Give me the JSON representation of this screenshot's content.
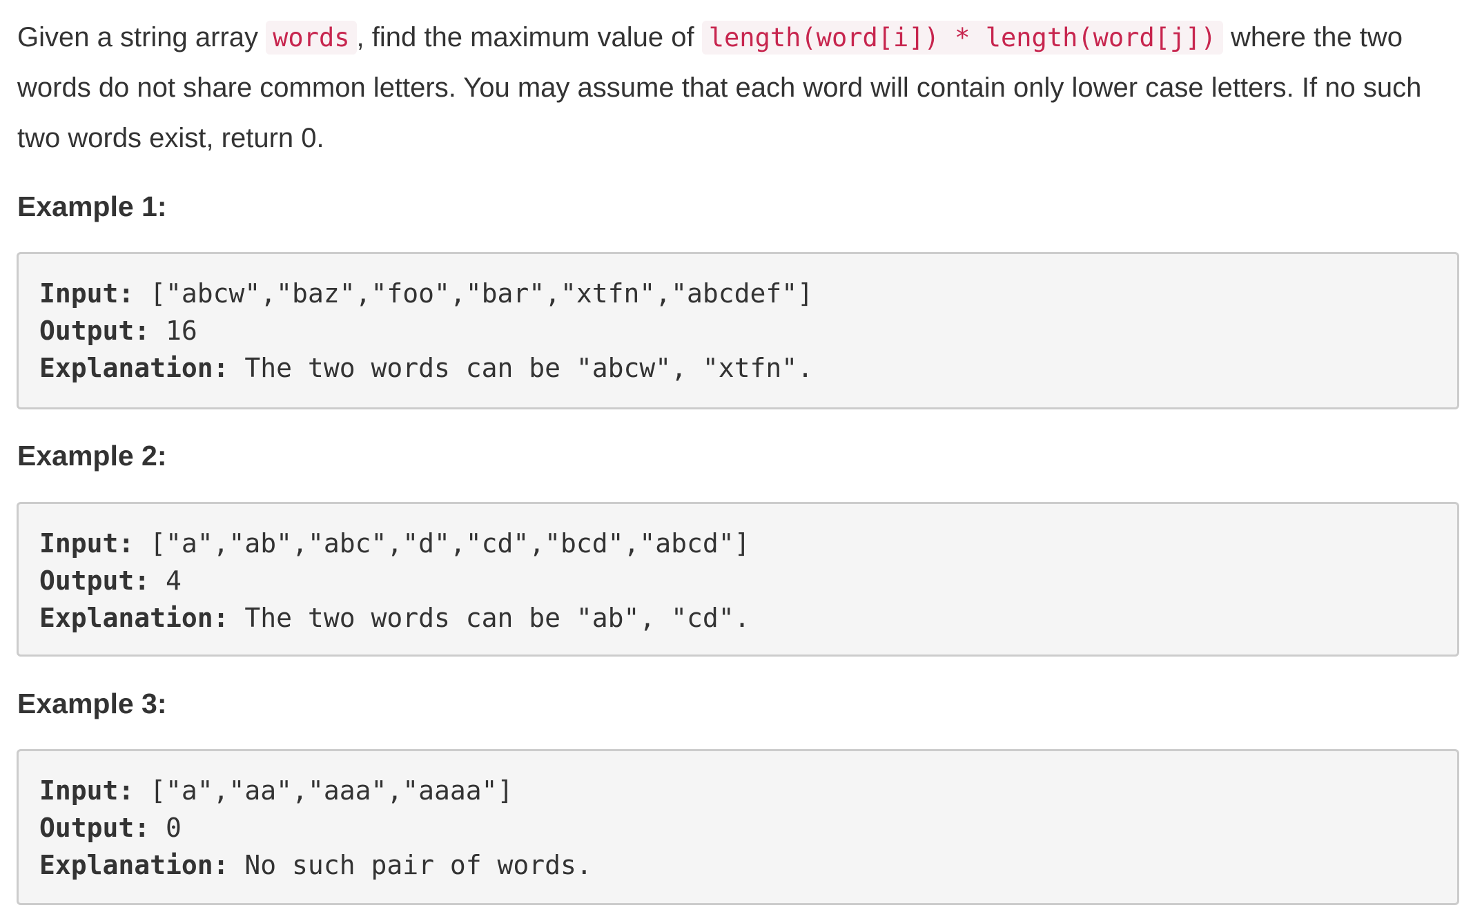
{
  "description": {
    "part1": "Given a string array ",
    "code1": "words",
    "part2": ", find the maximum value of ",
    "code2": "length(word[i]) * length(word[j])",
    "part3": " where the two words do not share common letters. You may assume that each word will contain only lower case letters. If no such two words exist, return 0."
  },
  "examples": [
    {
      "heading": "Example 1:",
      "input_label": "Input:",
      "input_value": " [\"abcw\",\"baz\",\"foo\",\"bar\",\"xtfn\",\"abcdef\"]",
      "output_label": "Output:",
      "output_value": " 16",
      "explanation_label": "Explanation:",
      "explanation_value": " The two words can be \"abcw\", \"xtfn\"."
    },
    {
      "heading": "Example 2:",
      "input_label": "Input:",
      "input_value": " [\"a\",\"ab\",\"abc\",\"d\",\"cd\",\"bcd\",\"abcd\"]",
      "output_label": "Output:",
      "output_value": " 4",
      "explanation_label": "Explanation:",
      "explanation_value": " The two words can be \"ab\", \"cd\"."
    },
    {
      "heading": "Example 3:",
      "input_label": "Input:",
      "input_value": " [\"a\",\"aa\",\"aaa\",\"aaaa\"]",
      "output_label": "Output:",
      "output_value": " 0",
      "explanation_label": "Explanation:",
      "explanation_value": " No such pair of words."
    }
  ],
  "colors": {
    "text": "#333333",
    "inline_code_text": "#c7254e",
    "inline_code_bg": "#f9f2f4",
    "box_bg": "#f5f5f5",
    "box_border": "#cccccc"
  }
}
